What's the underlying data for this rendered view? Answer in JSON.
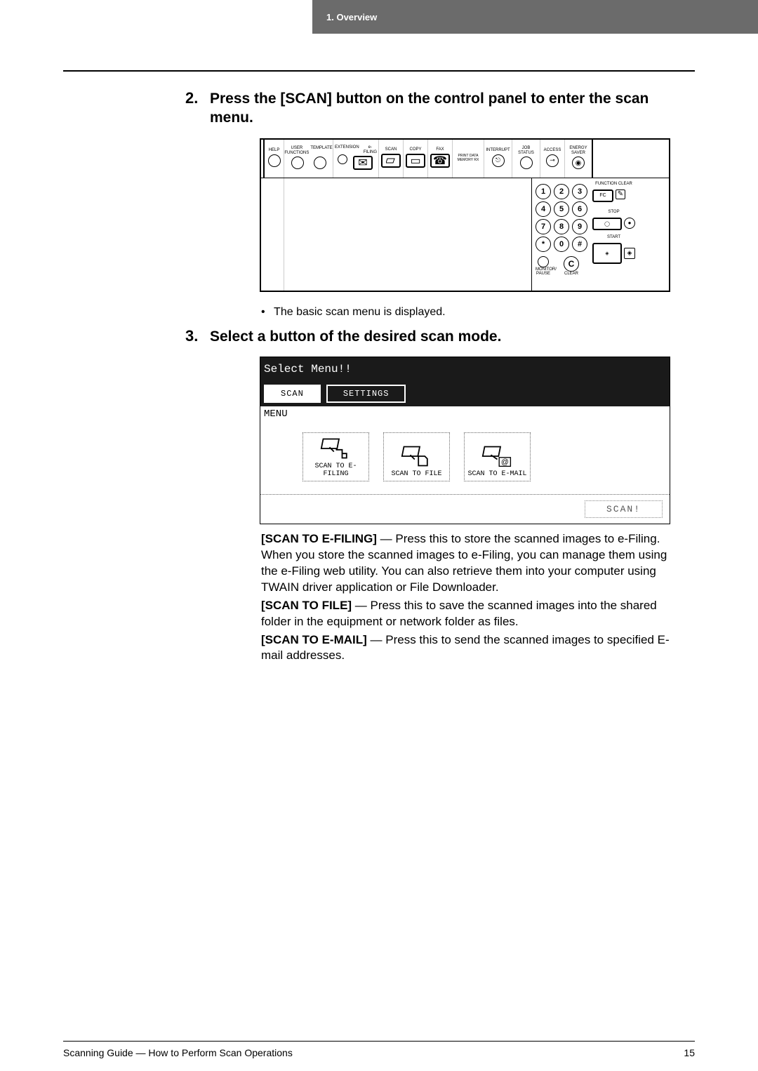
{
  "header": {
    "section": "1. Overview"
  },
  "step2": {
    "num": "2.",
    "text": "Press the [SCAN] button on the control panel to enter the scan menu."
  },
  "controlPanel": {
    "top": {
      "help": "HELP",
      "userFunctions": "USER FUNCTIONS",
      "template": "TEMPLATE",
      "extension": "EXTENSION",
      "efiling": "e-FILING",
      "scan": "SCAN",
      "copy": "COPY",
      "fax": "FAX",
      "printData": "PRINT DATA",
      "memoryRx": "MEMORY RX",
      "interrupt": "INTERRUPT",
      "jobStatus": "JOB STATUS",
      "access": "ACCESS",
      "energySaver": "ENERGY SAVER"
    },
    "keypad": {
      "keys": [
        "1",
        "2",
        "3",
        "4",
        "5",
        "6",
        "7",
        "8",
        "9",
        "*",
        "0",
        "#"
      ],
      "functionClear": "FUNCTION CLEAR",
      "fc": "FC",
      "stop": "STOP",
      "start": "START",
      "monitorPause": "MONITOR/ PAUSE",
      "clear": "CLEAR",
      "c": "C"
    }
  },
  "bullet1": "The basic scan menu is displayed.",
  "step3": {
    "num": "3.",
    "text": "Select a button of the desired scan mode."
  },
  "touchPanel": {
    "title": "Select Menu!!",
    "tabScan": "SCAN",
    "tabSettings": "SETTINGS",
    "menuLabel": "MENU",
    "btn1": "SCAN TO E-FILING",
    "btn2": "SCAN TO FILE",
    "btn3": "SCAN TO E-MAIL",
    "scanBtn": "SCAN!"
  },
  "desc": {
    "efiling_label": "[SCAN TO E-FILING]",
    "efiling": " — Press this to store the scanned images to e-Filing. When you store the scanned images to e-Filing, you can manage them using the e-Filing web utility.  You can also retrieve them into your computer using TWAIN driver application or File Downloader.",
    "file_label": "[SCAN TO FILE]",
    "file": " — Press this to save the scanned images into the shared folder in the equipment or network folder as files.",
    "email_label": "[SCAN TO E-MAIL]",
    "email": " — Press this to send the scanned images to specified E-mail addresses."
  },
  "footer": {
    "left": "Scanning Guide — How to Perform Scan Operations",
    "page": "15"
  }
}
